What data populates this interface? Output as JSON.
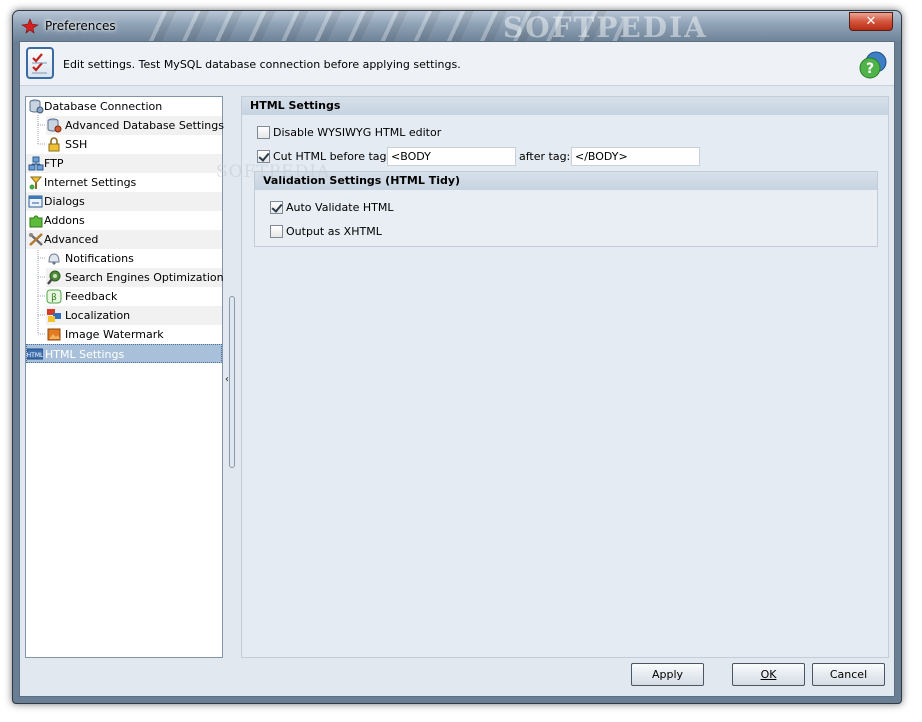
{
  "window": {
    "title": "Preferences",
    "close_label": "✕",
    "watermark": "SOFTPEDIA"
  },
  "header": {
    "text": "Edit settings. Test MySQL database connection before applying settings."
  },
  "tree": {
    "items": [
      {
        "label": "Database Connection",
        "icon": "database-icon"
      },
      {
        "label": "Advanced Database Settings",
        "icon": "database-settings-icon"
      },
      {
        "label": "SSH",
        "icon": "lock-icon"
      },
      {
        "label": "FTP",
        "icon": "network-icon"
      },
      {
        "label": "Internet Settings",
        "icon": "globe-icon"
      },
      {
        "label": "Dialogs",
        "icon": "window-icon"
      },
      {
        "label": "Addons",
        "icon": "puzzle-icon"
      },
      {
        "label": "Advanced",
        "icon": "tools-icon"
      },
      {
        "label": "Notifications",
        "icon": "bell-icon"
      },
      {
        "label": "Search Engines Optimization",
        "icon": "seo-icon"
      },
      {
        "label": "Feedback",
        "icon": "feedback-icon"
      },
      {
        "label": "Localization",
        "icon": "flags-icon"
      },
      {
        "label": "Image Watermark",
        "icon": "image-icon"
      },
      {
        "label": "HTML Settings",
        "icon": "html-icon"
      }
    ],
    "selected": "HTML Settings"
  },
  "panel": {
    "section_title": "HTML Settings",
    "disable_wysiwyg": {
      "label": "Disable WYSIWYG HTML editor",
      "checked": false
    },
    "cut_html": {
      "label": "Cut HTML before tag:",
      "checked": true,
      "value": "<BODY"
    },
    "after_tag": {
      "label": "after tag:",
      "value": "</BODY>"
    },
    "validation": {
      "title": "Validation Settings (HTML Tidy)",
      "auto_validate": {
        "label": "Auto Validate HTML",
        "checked": true
      },
      "output_xhtml": {
        "label": "Output as XHTML",
        "checked": false
      }
    }
  },
  "buttons": {
    "apply": "Apply",
    "ok": "OK",
    "cancel": "Cancel"
  }
}
